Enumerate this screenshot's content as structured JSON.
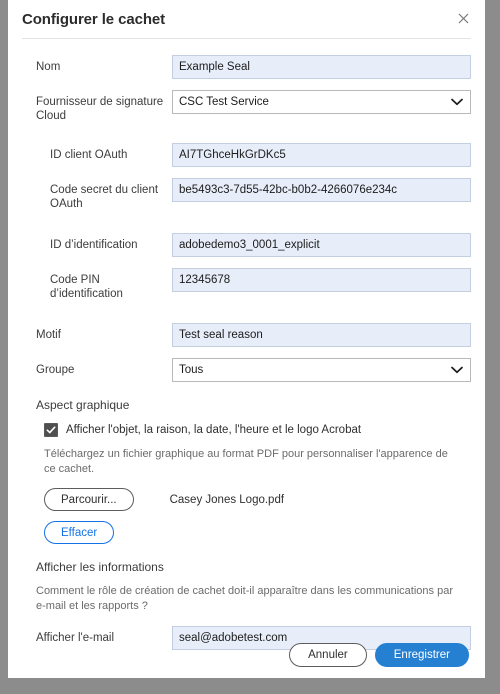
{
  "dialog": {
    "title": "Configurer le cachet",
    "close_icon": "close-icon"
  },
  "form": {
    "name": {
      "label": "Nom",
      "value": "Example Seal"
    },
    "provider": {
      "label": "Fournisseur de signature Cloud",
      "value": "CSC Test Service",
      "options": [
        "CSC Test Service"
      ]
    },
    "oauth_client_id": {
      "label": "ID client OAuth",
      "value": "AI7TGhceHkGrDKc5"
    },
    "oauth_client_secret": {
      "label": "Code secret du client OAuth",
      "value": "be5493c3-7d55-42bc-b0b2-4266076e234c"
    },
    "credential_id": {
      "label": "ID d’identification",
      "value": "adobedemo3_0001_explicit"
    },
    "credential_pin": {
      "label": "Code PIN d’identification",
      "value": "12345678"
    },
    "reason": {
      "label": "Motif",
      "value": "Test seal reason"
    },
    "group": {
      "label": "Groupe",
      "value": "Tous",
      "options": [
        "Tous"
      ]
    }
  },
  "appearance": {
    "section_title": "Aspect graphique",
    "checkbox_label": "Afficher l'objet, la raison, la date, l'heure et le logo Acrobat",
    "checkbox_checked": true,
    "helper_text": "Téléchargez un fichier graphique au format PDF pour personnaliser l'apparence de ce cachet.",
    "browse_label": "Parcourir...",
    "file_name": "Casey Jones Logo.pdf",
    "clear_label": "Effacer"
  },
  "info": {
    "section_title": "Afficher les informations",
    "helper_text": "Comment le rôle de création de cachet doit-il apparaître dans les communications par e-mail et les rapports ?",
    "email": {
      "label": "Afficher l'e-mail",
      "value": "seal@adobetest.com"
    }
  },
  "footer": {
    "cancel_label": "Annuler",
    "save_label": "Enregistrer"
  },
  "colors": {
    "accent_blue": "#1473e6",
    "save_blue": "#2680d2",
    "field_fill": "#e7edf9",
    "backdrop": "#8c8c8c"
  }
}
